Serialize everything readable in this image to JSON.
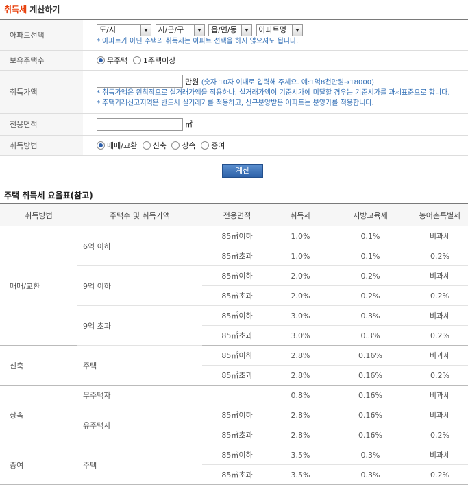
{
  "title": {
    "accent": "취득세",
    "rest": " 계산하기"
  },
  "form": {
    "apartment": {
      "label": "아파트선택",
      "selects": [
        "도/시",
        "시/군/구",
        "읍/면/동",
        "아파트명"
      ],
      "note": "* 아파트가 아닌 주택의 취득세는 아파트 선택을 하지 않으셔도 됩니다."
    },
    "owned": {
      "label": "보유주택수",
      "options": [
        "무주택",
        "1주택이상"
      ],
      "selected": "무주택"
    },
    "price": {
      "label": "취득가액",
      "value": "",
      "unit": "만원",
      "hint": "(숫자 10자 이내로 입력해 주세요. 예:1억8천만원→18000)",
      "notes": [
        "* 취득가액은 원칙적으로 실거래가액을 적용하나, 실거래가액이 기준시가에 미달할 경우는 기준시가를 과세표준으로 합니다.",
        "* 주택거래신고지역은 반드시 실거래가를 적용하고, 신규분양받은 아파트는 분양가를 적용합니다."
      ]
    },
    "area": {
      "label": "전용면적",
      "value": "",
      "unit": "㎡"
    },
    "method": {
      "label": "취득방법",
      "options": [
        "매매/교환",
        "신축",
        "상속",
        "증여"
      ],
      "selected": "매매/교환"
    }
  },
  "calc_button": "계산",
  "rate_table": {
    "title": "주택 취득세 요율표(참고)",
    "headers": [
      "취득방법",
      "주택수 및 취득가액",
      "전용면적",
      "취득세",
      "지방교육세",
      "농어촌특별세"
    ],
    "groups": [
      {
        "method": "매매/교환",
        "subs": [
          {
            "label": "6억 이하",
            "rows": [
              [
                "85㎡이하",
                "1.0%",
                "0.1%",
                "비과세"
              ],
              [
                "85㎡초과",
                "1.0%",
                "0.1%",
                "0.2%"
              ]
            ]
          },
          {
            "label": "9억 이하",
            "rows": [
              [
                "85㎡이하",
                "2.0%",
                "0.2%",
                "비과세"
              ],
              [
                "85㎡초과",
                "2.0%",
                "0.2%",
                "0.2%"
              ]
            ]
          },
          {
            "label": "9억 초과",
            "rows": [
              [
                "85㎡이하",
                "3.0%",
                "0.3%",
                "비과세"
              ],
              [
                "85㎡초과",
                "3.0%",
                "0.3%",
                "0.2%"
              ]
            ]
          }
        ]
      },
      {
        "method": "신축",
        "subs": [
          {
            "label": "주택",
            "rows": [
              [
                "85㎡이하",
                "2.8%",
                "0.16%",
                "비과세"
              ],
              [
                "85㎡초과",
                "2.8%",
                "0.16%",
                "0.2%"
              ]
            ]
          }
        ]
      },
      {
        "method": "상속",
        "subs": [
          {
            "label": "무주택자",
            "rows": [
              [
                "",
                "0.8%",
                "0.16%",
                "비과세"
              ]
            ]
          },
          {
            "label": "유주택자",
            "rows": [
              [
                "85㎡이하",
                "2.8%",
                "0.16%",
                "비과세"
              ],
              [
                "85㎡초과",
                "2.8%",
                "0.16%",
                "0.2%"
              ]
            ]
          }
        ]
      },
      {
        "method": "증여",
        "subs": [
          {
            "label": "주택",
            "rows": [
              [
                "85㎡이하",
                "3.5%",
                "0.3%",
                "비과세"
              ],
              [
                "85㎡초과",
                "3.5%",
                "0.3%",
                "0.2%"
              ]
            ]
          }
        ]
      }
    ]
  }
}
